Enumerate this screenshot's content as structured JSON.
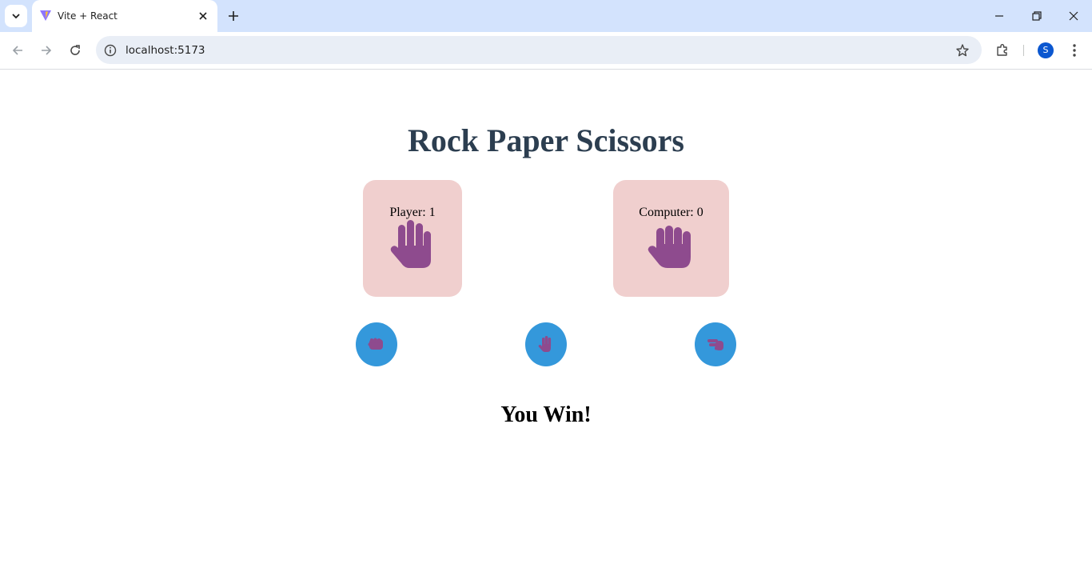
{
  "browser": {
    "tab_title": "Vite + React",
    "url": "localhost:5173",
    "profile_initial": "S"
  },
  "app": {
    "title": "Rock Paper Scissors",
    "player_score_label": "Player: 1",
    "computer_score_label": "Computer: 0",
    "player_choice_icon": "paper-hand-icon",
    "computer_choice_icon": "paper-hand-icon",
    "choices": [
      {
        "name": "rock",
        "icon": "rock-fist-icon"
      },
      {
        "name": "paper",
        "icon": "paper-hand-icon"
      },
      {
        "name": "scissors",
        "icon": "scissors-hand-icon"
      }
    ],
    "result": "You Win!"
  },
  "colors": {
    "title": "#2c3e50",
    "score_card_bg": "#f0cfce",
    "hand_icon": "#8e4b8e",
    "choice_button": "#3498db",
    "tabbar": "#d3e3fd"
  }
}
